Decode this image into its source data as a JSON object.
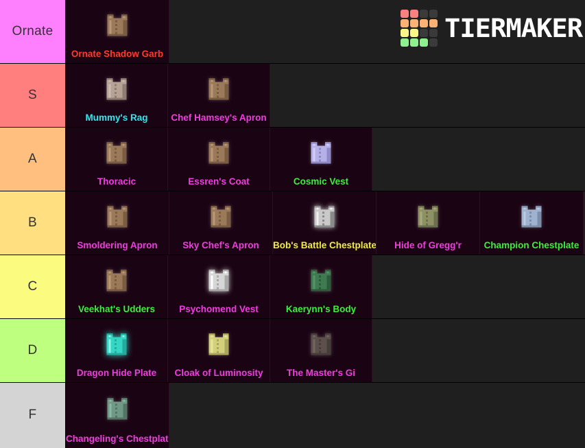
{
  "logo": {
    "wordmark": "TIERMAKER",
    "grid_colors": [
      "#f98080",
      "#f98080",
      "#3a3a3a",
      "#3a3a3a",
      "#f9b273",
      "#f9b273",
      "#f9b273",
      "#f9b273",
      "#faf489",
      "#faf489",
      "#3a3a3a",
      "#3a3a3a",
      "#8ef08e",
      "#8ef08e",
      "#8ef08e",
      "#3a3a3a"
    ]
  },
  "palette": {
    "empty_background": "#1f1f1f",
    "cell_background": "#1a0312",
    "divider": "#000000",
    "label_text": "#333333"
  },
  "tiers": [
    {
      "label": "Ornate",
      "color": "#ff80ff",
      "items": [
        {
          "name": "Ornate Shadow Garb",
          "text_color": "#ff3a2f",
          "icon": "chestplate-icon",
          "body": "#9b7a5a",
          "shade": "#7a5c42",
          "light": "#b89878",
          "glow": "none"
        }
      ]
    },
    {
      "label": "S",
      "color": "#ff7f7f",
      "items": [
        {
          "name": "Mummy's Rag",
          "text_color": "#2ee8f0",
          "icon": "chestplate-icon",
          "body": "#b6a396",
          "shade": "#8f7d71",
          "light": "#cbbbb0",
          "glow": "none"
        },
        {
          "name": "Chef Hamsey's Apron",
          "text_color": "#f03ce0",
          "icon": "chestplate-icon",
          "body": "#9b7a5a",
          "shade": "#7a5c42",
          "light": "#b89878",
          "glow": "none"
        }
      ]
    },
    {
      "label": "A",
      "color": "#ffbf7f",
      "items": [
        {
          "name": "Thoracic",
          "text_color": "#f03ce0",
          "icon": "chestplate-icon",
          "body": "#9b7a5a",
          "shade": "#7a5c42",
          "light": "#b89878",
          "glow": "none"
        },
        {
          "name": "Essren's Coat",
          "text_color": "#f03ce0",
          "icon": "chestplate-icon",
          "body": "#9b7a5a",
          "shade": "#7a5c42",
          "light": "#b89878",
          "glow": "none"
        },
        {
          "name": "Cosmic Vest",
          "text_color": "#3cf03c",
          "icon": "chestplate-icon",
          "body": "#b6b0e8",
          "shade": "#8f88c9",
          "light": "#d2cef5",
          "glow": "none"
        }
      ]
    },
    {
      "label": "B",
      "color": "#ffdf7f",
      "items": [
        {
          "name": "Smoldering Apron",
          "text_color": "#f03ce0",
          "icon": "chestplate-icon",
          "body": "#9b7a5a",
          "shade": "#7a5c42",
          "light": "#b89878",
          "glow": "none"
        },
        {
          "name": "Sky Chef's Apron",
          "text_color": "#f03ce0",
          "icon": "chestplate-icon",
          "body": "#9b7a5a",
          "shade": "#7a5c42",
          "light": "#b89878",
          "glow": "none"
        },
        {
          "name": "Bob's Battle Chestplate",
          "text_color": "#f0f03c",
          "icon": "chestplate-icon",
          "body": "#c9c9c9",
          "shade": "#8a8a8a",
          "light": "#efefef",
          "glow": "white"
        },
        {
          "name": "Hide of Gregg'r",
          "text_color": "#f03ce0",
          "icon": "chestplate-icon",
          "body": "#8d9163",
          "shade": "#6c6f4c",
          "light": "#a7ab7c",
          "glow": "none"
        },
        {
          "name": "Champion Chestplate",
          "text_color": "#3cf03c",
          "icon": "chestplate-icon",
          "body": "#9fb2cf",
          "shade": "#7b8da8",
          "light": "#bdcbe2",
          "glow": "none"
        }
      ]
    },
    {
      "label": "C",
      "color": "#fbfb7f",
      "items": [
        {
          "name": "Veekhat's Udders",
          "text_color": "#3cf03c",
          "icon": "chestplate-icon",
          "body": "#9b7a5a",
          "shade": "#7a5c42",
          "light": "#b89878",
          "glow": "none"
        },
        {
          "name": "Psychomend Vest",
          "text_color": "#f03ce0",
          "icon": "chestplate-icon",
          "body": "#d6d6d6",
          "shade": "#a8a8a8",
          "light": "#ffffff",
          "glow": "white"
        },
        {
          "name": "Kaerynn's Body",
          "text_color": "#3cf03c",
          "icon": "chestplate-icon",
          "body": "#3f7a50",
          "shade": "#2d5b3b",
          "light": "#559468",
          "glow": "none"
        }
      ]
    },
    {
      "label": "D",
      "color": "#bfff7f",
      "items": [
        {
          "name": "Dragon Hide Plate",
          "text_color": "#f03ce0",
          "icon": "chestplate-icon",
          "body": "#35d6c4",
          "shade": "#25ab9c",
          "light": "#8ff3e8",
          "glow": "cyan"
        },
        {
          "name": "Cloak of Luminosity",
          "text_color": "#f03ce0",
          "icon": "chestplate-icon",
          "body": "#d2d07a",
          "shade": "#a9a75d",
          "light": "#e8e69b",
          "glow": "none"
        },
        {
          "name": "The Master's Gi",
          "text_color": "#f03ce0",
          "icon": "chestplate-icon",
          "body": "#5c4f4c",
          "shade": "#463c39",
          "light": "#746561",
          "glow": "none"
        }
      ]
    },
    {
      "label": "F",
      "color": "#d4d4d4",
      "items": [
        {
          "name": "Changeling's Chestplate",
          "text_color": "#f03ce0",
          "icon": "chestplate-icon",
          "body": "#6f9a87",
          "shade": "#547566",
          "light": "#8cb8a4",
          "glow": "none"
        }
      ]
    }
  ]
}
